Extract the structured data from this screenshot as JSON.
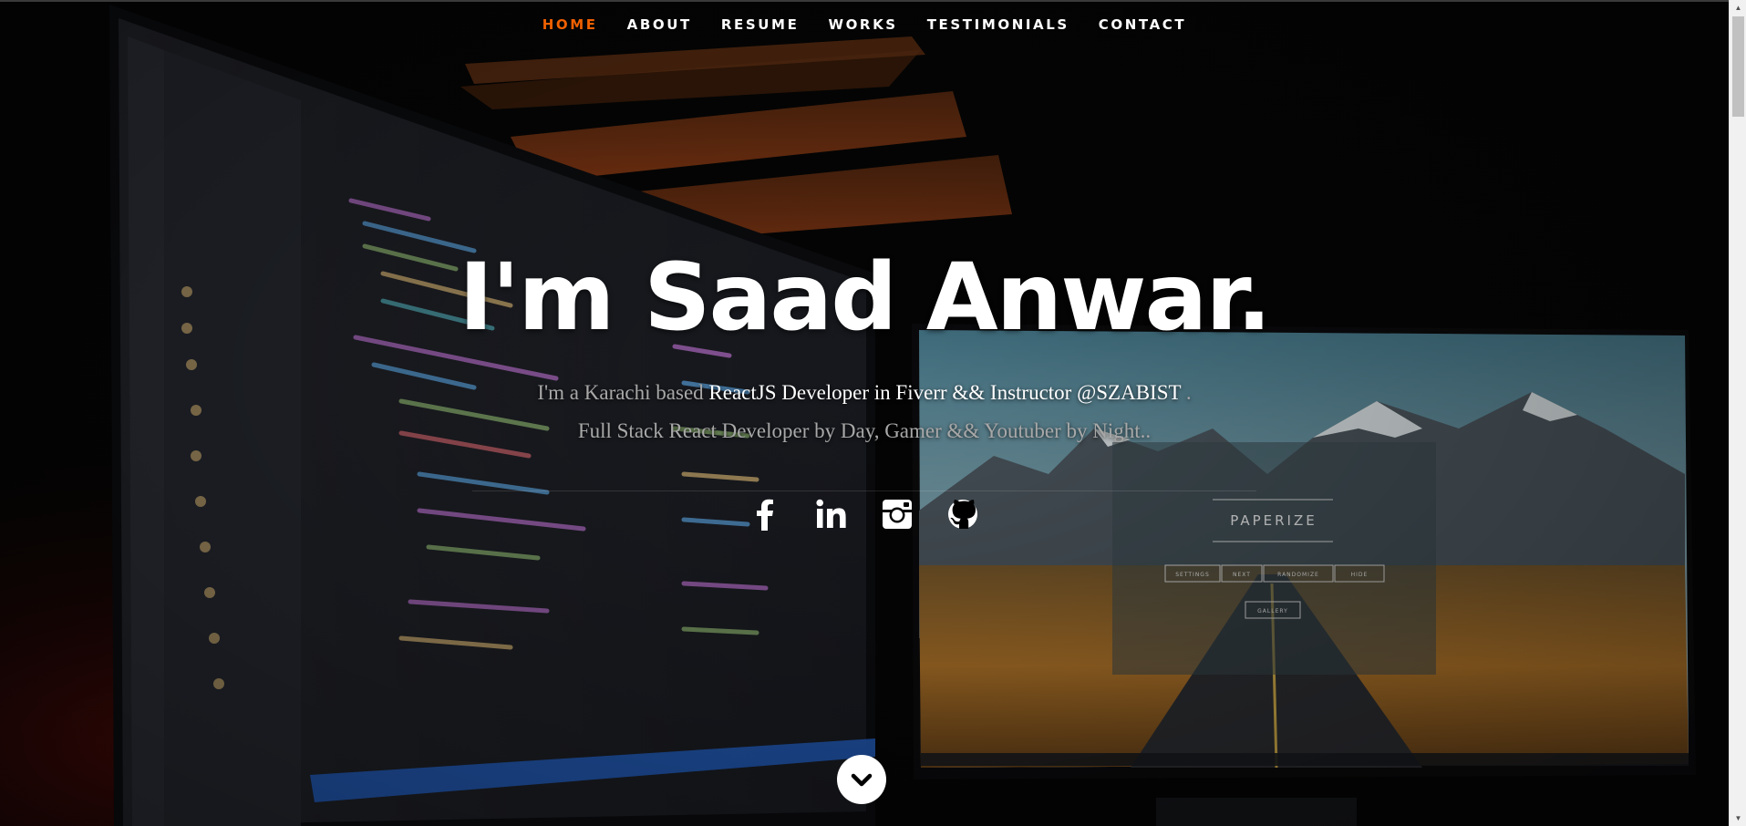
{
  "nav": {
    "items": [
      {
        "label": "HOME",
        "current": true
      },
      {
        "label": "ABOUT",
        "current": false
      },
      {
        "label": "RESUME",
        "current": false
      },
      {
        "label": "WORKS",
        "current": false
      },
      {
        "label": "TESTIMONIALS",
        "current": false
      },
      {
        "label": "CONTACT",
        "current": false
      }
    ],
    "accent_color": "#F06000"
  },
  "banner": {
    "heading": "I'm Saad Anwar.",
    "intro_prefix": "I'm a Karachi based",
    "intro_highlight": "ReactJS Developer in Fiverr && Instructor @SZABIST",
    "intro_suffix": ".",
    "tagline": "Full Stack React Developer by Day, Gamer && Youtuber by Night.."
  },
  "background_screen": {
    "app_title": "PAPERIZE",
    "buttons": [
      "SETTINGS",
      "NEXT",
      "RANDOMIZE",
      "HIDE"
    ],
    "gallery_label": "GALLERY"
  },
  "social": [
    {
      "icon": "facebook-icon"
    },
    {
      "icon": "linkedin-icon"
    },
    {
      "icon": "instagram-icon"
    },
    {
      "icon": "github-icon"
    }
  ],
  "scroll_down": {
    "icon": "chevron-down-icon"
  }
}
